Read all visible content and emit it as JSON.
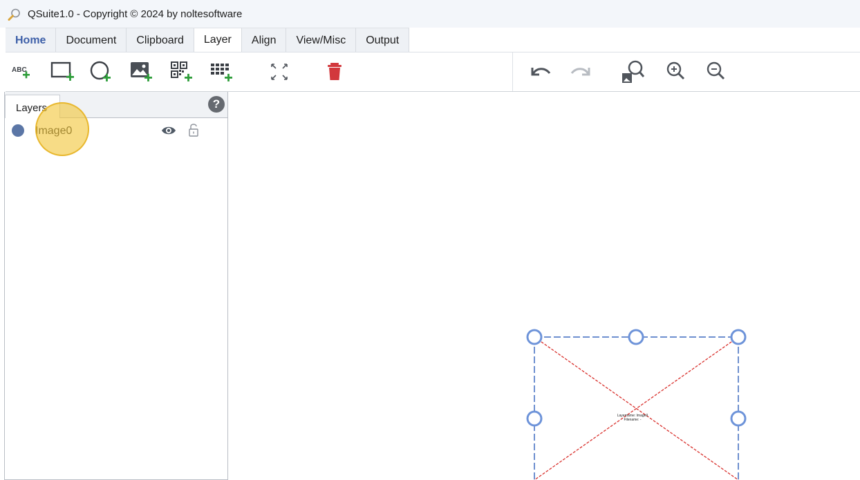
{
  "window": {
    "title": "QSuite1.0 - Copyright © 2024 by noltesoftware",
    "icon": "magnifier-icon"
  },
  "ribbon": {
    "tabs": [
      {
        "label": "Home"
      },
      {
        "label": "Document"
      },
      {
        "label": "Clipboard"
      },
      {
        "label": "Layer"
      },
      {
        "label": "Align"
      },
      {
        "label": "View/Misc"
      },
      {
        "label": "Output"
      }
    ],
    "active_tab": "Layer",
    "tools": {
      "add_text_badge": "ABC",
      "add_text": "add-text-icon",
      "add_rectangle": "add-rectangle-icon",
      "add_ellipse": "add-ellipse-icon",
      "add_image": "add-image-icon",
      "add_qrcode": "add-qrcode-icon",
      "add_barcode": "add-barcode-icon",
      "fit": "expand-icon",
      "delete": "trash-icon",
      "undo": "undo-icon",
      "redo": "redo-icon",
      "zoom_fit": "zoom-page-icon",
      "zoom_in": "zoom-in-icon",
      "zoom_out": "zoom-out-icon"
    }
  },
  "layers_panel": {
    "tab_label": "Layers",
    "help_label": "?",
    "items": [
      {
        "name": "Image0",
        "color": "#5b76a6",
        "visible": true,
        "locked": false
      }
    ]
  },
  "canvas": {
    "placeholder_caption": "Layername: Image0\nFilename: -"
  },
  "colors": {
    "accent": "#3d5fa8",
    "selection_handle": "#6d93d9",
    "placeholder_cross": "#d9302c",
    "delete_red": "#d2383d",
    "highlight": "#f2c63c"
  }
}
